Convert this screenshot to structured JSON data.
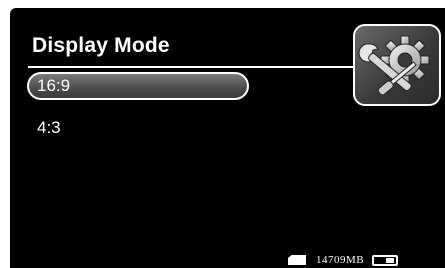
{
  "header": {
    "title": "Display Mode"
  },
  "settings": {
    "icon": "settings-tools-icon"
  },
  "menu": {
    "items": [
      {
        "label": "16:9",
        "selected": true
      },
      {
        "label": "4:3",
        "selected": false
      }
    ]
  },
  "status": {
    "storage_label": "14709MB",
    "card_icon": "memory-card-icon",
    "battery_icon": "battery-icon"
  },
  "colors": {
    "background": "#000000",
    "text": "#ffffff",
    "selection_fill": "#5a5a5a"
  }
}
